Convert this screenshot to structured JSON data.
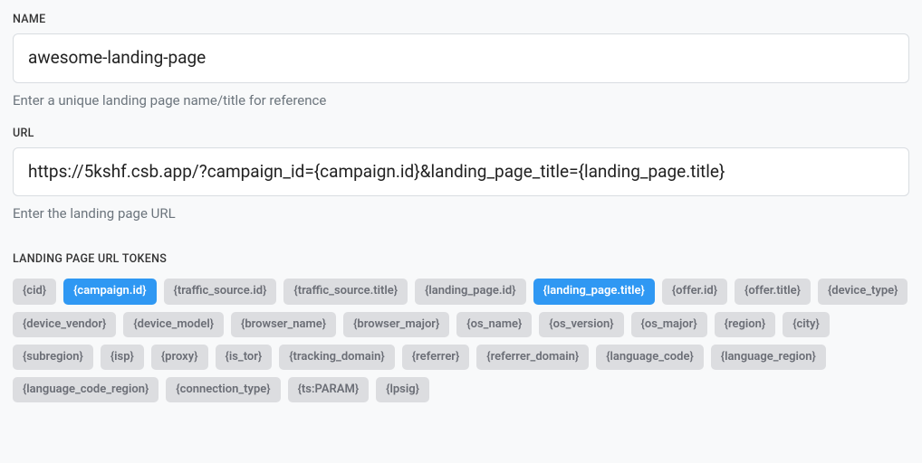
{
  "fields": {
    "name": {
      "label": "NAME",
      "value": "awesome-landing-page",
      "help": "Enter a unique landing page name/title for reference"
    },
    "url": {
      "label": "URL",
      "value": "https://5kshf.csb.app/?campaign_id={campaign.id}&landing_page_title={landing_page.title}",
      "help": "Enter the landing page URL"
    }
  },
  "tokens_section_label": "LANDING PAGE URL TOKENS",
  "tokens": [
    {
      "text": "{cid}",
      "active": false
    },
    {
      "text": "{campaign.id}",
      "active": true
    },
    {
      "text": "{traffic_source.id}",
      "active": false
    },
    {
      "text": "{traffic_source.title}",
      "active": false
    },
    {
      "text": "{landing_page.id}",
      "active": false
    },
    {
      "text": "{landing_page.title}",
      "active": true
    },
    {
      "text": "{offer.id}",
      "active": false
    },
    {
      "text": "{offer.title}",
      "active": false
    },
    {
      "text": "{device_type}",
      "active": false
    },
    {
      "text": "{device_vendor}",
      "active": false
    },
    {
      "text": "{device_model}",
      "active": false
    },
    {
      "text": "{browser_name}",
      "active": false
    },
    {
      "text": "{browser_major}",
      "active": false
    },
    {
      "text": "{os_name}",
      "active": false
    },
    {
      "text": "{os_version}",
      "active": false
    },
    {
      "text": "{os_major}",
      "active": false
    },
    {
      "text": "{region}",
      "active": false
    },
    {
      "text": "{city}",
      "active": false
    },
    {
      "text": "{subregion}",
      "active": false
    },
    {
      "text": "{isp}",
      "active": false
    },
    {
      "text": "{proxy}",
      "active": false
    },
    {
      "text": "{is_tor}",
      "active": false
    },
    {
      "text": "{tracking_domain}",
      "active": false
    },
    {
      "text": "{referrer}",
      "active": false
    },
    {
      "text": "{referrer_domain}",
      "active": false
    },
    {
      "text": "{language_code}",
      "active": false
    },
    {
      "text": "{language_region}",
      "active": false
    },
    {
      "text": "{language_code_region}",
      "active": false
    },
    {
      "text": "{connection_type}",
      "active": false
    },
    {
      "text": "{ts:PARAM}",
      "active": false
    },
    {
      "text": "{lpsig}",
      "active": false
    }
  ]
}
